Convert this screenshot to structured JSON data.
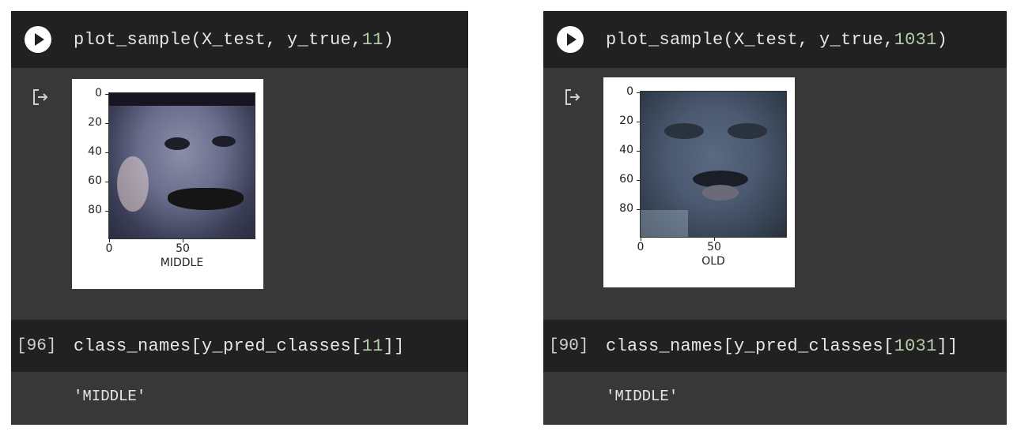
{
  "cells": [
    {
      "code_prefix": "plot_sample(X_test, y_true,",
      "code_arg": "11",
      "code_suffix": ")",
      "figure": {
        "y_ticks": [
          "0",
          "20",
          "40",
          "60",
          "80"
        ],
        "x_ticks": [
          "0",
          "50"
        ],
        "xlabel": "MIDDLE"
      },
      "exec_count": "[96]",
      "code2_prefix": "class_names[y_pred_classes[",
      "code2_arg": "11",
      "code2_suffix": "]]",
      "result": "'MIDDLE'"
    },
    {
      "code_prefix": "plot_sample(X_test, y_true,",
      "code_arg": "1031",
      "code_suffix": ")",
      "figure": {
        "y_ticks": [
          "0",
          "20",
          "40",
          "60",
          "80"
        ],
        "x_ticks": [
          "0",
          "50"
        ],
        "xlabel": "OLD"
      },
      "exec_count": "[90]",
      "code2_prefix": "class_names[y_pred_classes[",
      "code2_arg": "1031",
      "code2_suffix": "]]",
      "result": "'MIDDLE'"
    }
  ],
  "icons": {
    "run": "play-circle-icon",
    "output": "output-redirect-icon"
  },
  "colors": {
    "code_bg": "#212121",
    "output_bg": "#383838",
    "number_literal": "#b5cea8"
  }
}
